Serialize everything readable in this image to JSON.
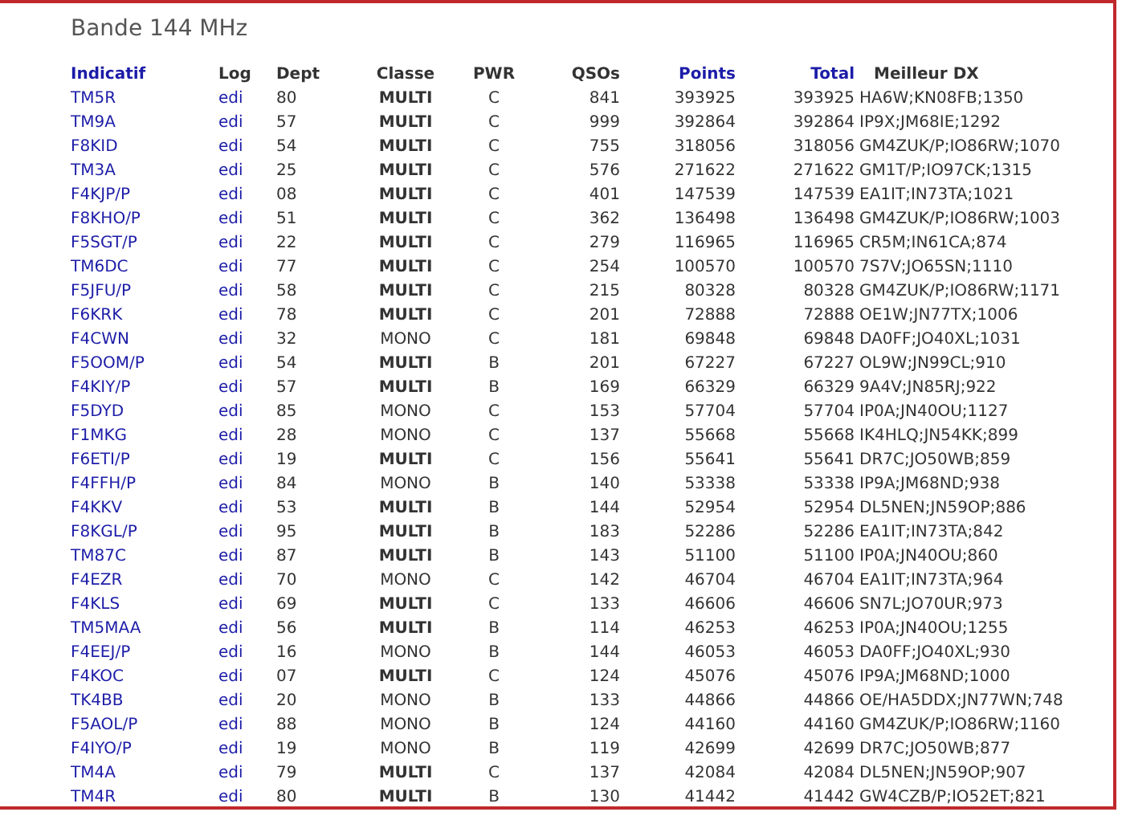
{
  "title": "Bande 144 MHz",
  "columns": [
    {
      "label": "Indicatif",
      "link": true
    },
    {
      "label": "Log",
      "link": false
    },
    {
      "label": "Dept",
      "link": false
    },
    {
      "label": "Classe",
      "link": false
    },
    {
      "label": "PWR",
      "link": false
    },
    {
      "label": "QSOs",
      "link": false
    },
    {
      "label": "Points",
      "link": true
    },
    {
      "label": "Total",
      "link": true
    },
    {
      "label": "Meilleur DX",
      "link": false
    }
  ],
  "rows": [
    {
      "call": "TM5R",
      "log": "edi",
      "dept": "80",
      "classe": "MULTI",
      "bold": true,
      "pwr": "C",
      "qsos": "841",
      "points": "393925",
      "total": "393925",
      "dx": "HA6W;KN08FB;1350"
    },
    {
      "call": "TM9A",
      "log": "edi",
      "dept": "57",
      "classe": "MULTI",
      "bold": true,
      "pwr": "C",
      "qsos": "999",
      "points": "392864",
      "total": "392864",
      "dx": "IP9X;JM68IE;1292"
    },
    {
      "call": "F8KID",
      "log": "edi",
      "dept": "54",
      "classe": "MULTI",
      "bold": true,
      "pwr": "C",
      "qsos": "755",
      "points": "318056",
      "total": "318056",
      "dx": "GM4ZUK/P;IO86RW;1070"
    },
    {
      "call": "TM3A",
      "log": "edi",
      "dept": "25",
      "classe": "MULTI",
      "bold": true,
      "pwr": "C",
      "qsos": "576",
      "points": "271622",
      "total": "271622",
      "dx": "GM1T/P;IO97CK;1315"
    },
    {
      "call": "F4KJP/P",
      "log": "edi",
      "dept": "08",
      "classe": "MULTI",
      "bold": true,
      "pwr": "C",
      "qsos": "401",
      "points": "147539",
      "total": "147539",
      "dx": "EA1IT;IN73TA;1021"
    },
    {
      "call": "F8KHO/P",
      "log": "edi",
      "dept": "51",
      "classe": "MULTI",
      "bold": true,
      "pwr": "C",
      "qsos": "362",
      "points": "136498",
      "total": "136498",
      "dx": "GM4ZUK/P;IO86RW;1003"
    },
    {
      "call": "F5SGT/P",
      "log": "edi",
      "dept": "22",
      "classe": "MULTI",
      "bold": true,
      "pwr": "C",
      "qsos": "279",
      "points": "116965",
      "total": "116965",
      "dx": "CR5M;IN61CA;874"
    },
    {
      "call": "TM6DC",
      "log": "edi",
      "dept": "77",
      "classe": "MULTI",
      "bold": true,
      "pwr": "C",
      "qsos": "254",
      "points": "100570",
      "total": "100570",
      "dx": "7S7V;JO65SN;1110"
    },
    {
      "call": "F5JFU/P",
      "log": "edi",
      "dept": "58",
      "classe": "MULTI",
      "bold": true,
      "pwr": "C",
      "qsos": "215",
      "points": "80328",
      "total": "80328",
      "dx": "GM4ZUK/P;IO86RW;1171"
    },
    {
      "call": "F6KRK",
      "log": "edi",
      "dept": "78",
      "classe": "MULTI",
      "bold": true,
      "pwr": "C",
      "qsos": "201",
      "points": "72888",
      "total": "72888",
      "dx": "OE1W;JN77TX;1006"
    },
    {
      "call": "F4CWN",
      "log": "edi",
      "dept": "32",
      "classe": "MONO",
      "bold": false,
      "pwr": "C",
      "qsos": "181",
      "points": "69848",
      "total": "69848",
      "dx": "DA0FF;JO40XL;1031"
    },
    {
      "call": "F5OOM/P",
      "log": "edi",
      "dept": "54",
      "classe": "MULTI",
      "bold": true,
      "pwr": "B",
      "qsos": "201",
      "points": "67227",
      "total": "67227",
      "dx": "OL9W;JN99CL;910"
    },
    {
      "call": "F4KIY/P",
      "log": "edi",
      "dept": "57",
      "classe": "MULTI",
      "bold": true,
      "pwr": "B",
      "qsos": "169",
      "points": "66329",
      "total": "66329",
      "dx": "9A4V;JN85RJ;922"
    },
    {
      "call": "F5DYD",
      "log": "edi",
      "dept": "85",
      "classe": "MONO",
      "bold": false,
      "pwr": "C",
      "qsos": "153",
      "points": "57704",
      "total": "57704",
      "dx": "IP0A;JN40OU;1127"
    },
    {
      "call": "F1MKG",
      "log": "edi",
      "dept": "28",
      "classe": "MONO",
      "bold": false,
      "pwr": "C",
      "qsos": "137",
      "points": "55668",
      "total": "55668",
      "dx": "IK4HLQ;JN54KK;899"
    },
    {
      "call": "F6ETI/P",
      "log": "edi",
      "dept": "19",
      "classe": "MULTI",
      "bold": true,
      "pwr": "C",
      "qsos": "156",
      "points": "55641",
      "total": "55641",
      "dx": "DR7C;JO50WB;859"
    },
    {
      "call": "F4FFH/P",
      "log": "edi",
      "dept": "84",
      "classe": "MONO",
      "bold": false,
      "pwr": "B",
      "qsos": "140",
      "points": "53338",
      "total": "53338",
      "dx": "IP9A;JM68ND;938"
    },
    {
      "call": "F4KKV",
      "log": "edi",
      "dept": "53",
      "classe": "MULTI",
      "bold": true,
      "pwr": "B",
      "qsos": "144",
      "points": "52954",
      "total": "52954",
      "dx": "DL5NEN;JN59OP;886"
    },
    {
      "call": "F8KGL/P",
      "log": "edi",
      "dept": "95",
      "classe": "MULTI",
      "bold": true,
      "pwr": "B",
      "qsos": "183",
      "points": "52286",
      "total": "52286",
      "dx": "EA1IT;IN73TA;842"
    },
    {
      "call": "TM87C",
      "log": "edi",
      "dept": "87",
      "classe": "MULTI",
      "bold": true,
      "pwr": "B",
      "qsos": "143",
      "points": "51100",
      "total": "51100",
      "dx": "IP0A;JN40OU;860"
    },
    {
      "call": "F4EZR",
      "log": "edi",
      "dept": "70",
      "classe": "MONO",
      "bold": false,
      "pwr": "C",
      "qsos": "142",
      "points": "46704",
      "total": "46704",
      "dx": "EA1IT;IN73TA;964"
    },
    {
      "call": "F4KLS",
      "log": "edi",
      "dept": "69",
      "classe": "MULTI",
      "bold": true,
      "pwr": "C",
      "qsos": "133",
      "points": "46606",
      "total": "46606",
      "dx": "SN7L;JO70UR;973"
    },
    {
      "call": "TM5MAA",
      "log": "edi",
      "dept": "56",
      "classe": "MULTI",
      "bold": true,
      "pwr": "B",
      "qsos": "114",
      "points": "46253",
      "total": "46253",
      "dx": "IP0A;JN40OU;1255"
    },
    {
      "call": "F4EEJ/P",
      "log": "edi",
      "dept": "16",
      "classe": "MONO",
      "bold": false,
      "pwr": "B",
      "qsos": "144",
      "points": "46053",
      "total": "46053",
      "dx": "DA0FF;JO40XL;930"
    },
    {
      "call": "F4KOC",
      "log": "edi",
      "dept": "07",
      "classe": "MULTI",
      "bold": true,
      "pwr": "C",
      "qsos": "124",
      "points": "45076",
      "total": "45076",
      "dx": "IP9A;JM68ND;1000"
    },
    {
      "call": "TK4BB",
      "log": "edi",
      "dept": "20",
      "classe": "MONO",
      "bold": false,
      "pwr": "B",
      "qsos": "133",
      "points": "44866",
      "total": "44866",
      "dx": "OE/HA5DDX;JN77WN;748"
    },
    {
      "call": "F5AOL/P",
      "log": "edi",
      "dept": "88",
      "classe": "MONO",
      "bold": false,
      "pwr": "B",
      "qsos": "124",
      "points": "44160",
      "total": "44160",
      "dx": "GM4ZUK/P;IO86RW;1160"
    },
    {
      "call": "F4IYO/P",
      "log": "edi",
      "dept": "19",
      "classe": "MONO",
      "bold": false,
      "pwr": "B",
      "qsos": "119",
      "points": "42699",
      "total": "42699",
      "dx": "DR7C;JO50WB;877"
    },
    {
      "call": "TM4A",
      "log": "edi",
      "dept": "79",
      "classe": "MULTI",
      "bold": true,
      "pwr": "C",
      "qsos": "137",
      "points": "42084",
      "total": "42084",
      "dx": "DL5NEN;JN59OP;907"
    },
    {
      "call": "TM4R",
      "log": "edi",
      "dept": "80",
      "classe": "MULTI",
      "bold": true,
      "pwr": "B",
      "qsos": "130",
      "points": "41442",
      "total": "41442",
      "dx": "GW4CZB/P;IO52ET;821"
    }
  ]
}
